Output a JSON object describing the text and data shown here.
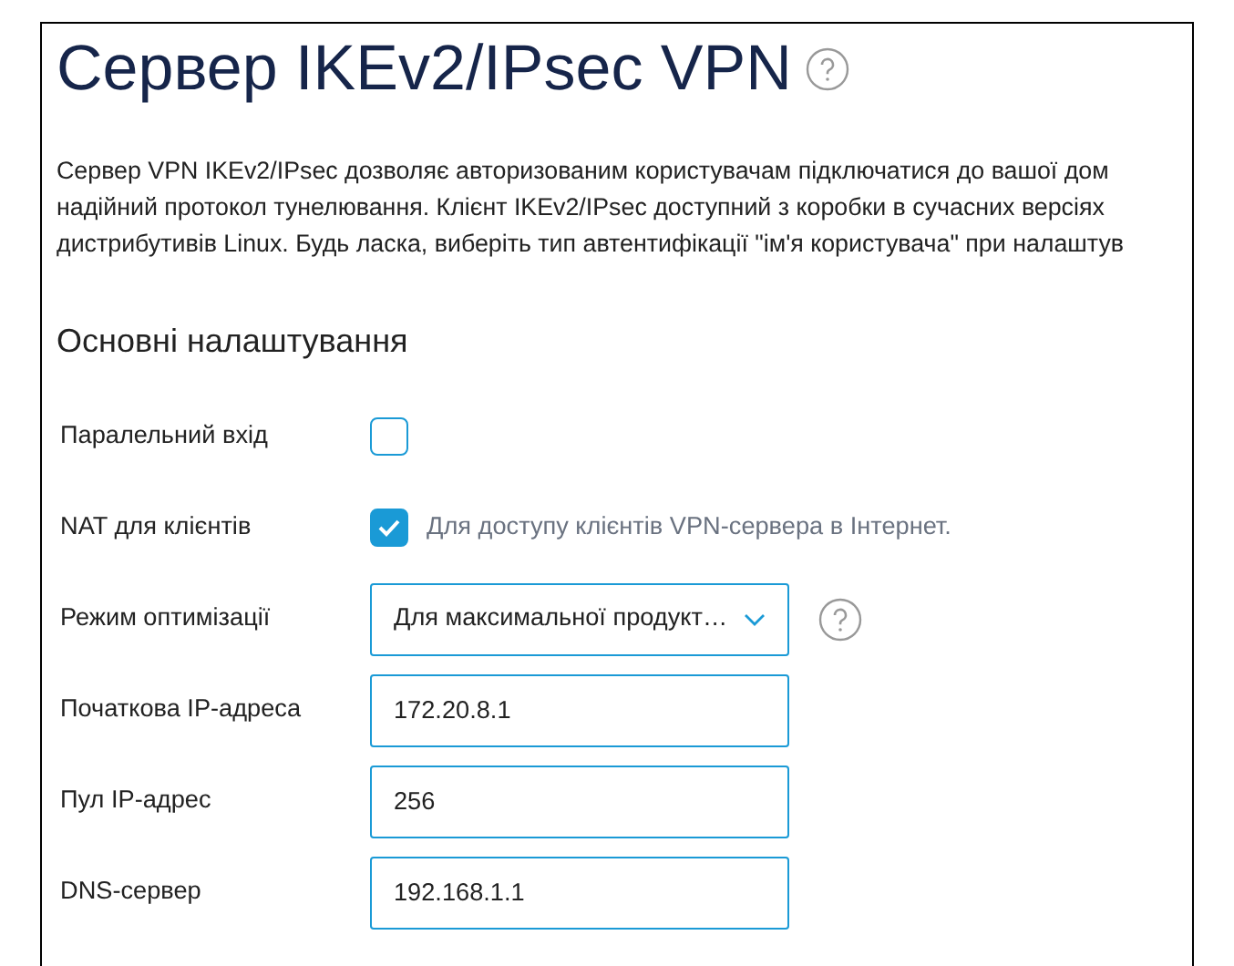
{
  "title": "Сервер IKEv2/IPsec VPN",
  "description_lines": [
    "Сервер VPN IKEv2/IPsec дозволяє авторизованим користувачам підключатися до вашої дом",
    "надійний протокол тунелювання. Клієнт IKEv2/IPsec доступний з коробки в сучасних версіях",
    "дистрибутивів Linux. Будь ласка, виберіть тип автентифікації \"ім'я користувача\" при налаштув"
  ],
  "section_title": "Основні налаштування",
  "settings": [
    {
      "kind": "checkbox",
      "label": "Паралельний вхід",
      "checked": false
    },
    {
      "kind": "checkbox",
      "label": "NAT для клієнтів",
      "checked": true,
      "hint": "Для доступу клієнтів VPN-сервера в Інтернет."
    },
    {
      "kind": "select",
      "label": "Режим оптимізації",
      "value": "Для максимальної продукт…",
      "help": true
    },
    {
      "kind": "text",
      "label": "Початкова IP-адреса",
      "value": "172.20.8.1"
    },
    {
      "kind": "text",
      "label": "Пул IP-адрес",
      "value": "256"
    },
    {
      "kind": "text",
      "label": "DNS-сервер",
      "value": "192.168.1.1"
    }
  ]
}
